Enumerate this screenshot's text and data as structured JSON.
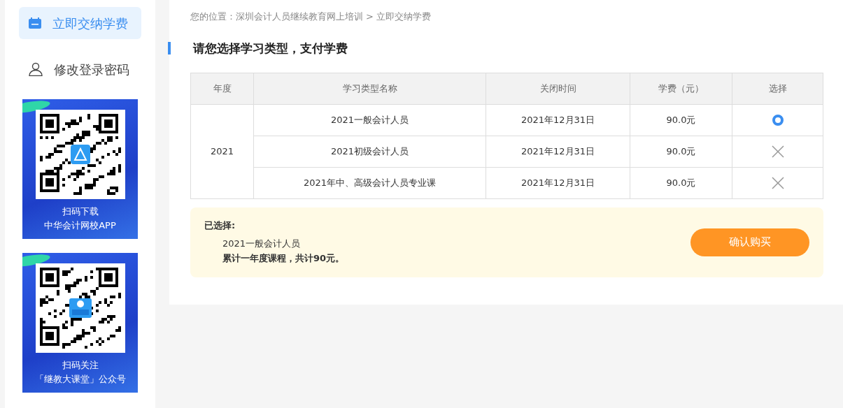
{
  "sidebar": {
    "items": [
      {
        "label": "立即交纳学费",
        "selected": true
      },
      {
        "label": "修改登录密码",
        "selected": false
      }
    ],
    "promos": [
      {
        "title": "扫码下载",
        "subtitle": "中华会计网校APP"
      },
      {
        "title": "扫码关注",
        "subtitle": "「继教大课堂」公众号"
      }
    ]
  },
  "breadcrumb": {
    "prefix": "您的位置：",
    "items": [
      "深圳会计人员继续教育网上培训",
      "立即交纳学费"
    ],
    "separator": ">"
  },
  "heading": "请您选择学习类型，支付学费",
  "table": {
    "columns": [
      "年度",
      "学习类型名称",
      "关闭时间",
      "学费（元）",
      "选择"
    ],
    "groups": [
      {
        "year": "2021",
        "rows": [
          {
            "name": "2021一般会计人员",
            "close_time": "2021年12月31日",
            "fee": "90.0元",
            "kind": "radio",
            "selected": true
          },
          {
            "name": "2021初级会计人员",
            "close_time": "2021年12月31日",
            "fee": "90.0元",
            "kind": "unavailable",
            "selected": false
          },
          {
            "name": "2021年中、高级会计人员专业课",
            "close_time": "2021年12月31日",
            "fee": "90.0元",
            "kind": "unavailable",
            "selected": false
          }
        ]
      }
    ]
  },
  "summary": {
    "label": "已选择:",
    "item": "2021一般会计人员",
    "total": "累计一年度课程，共计90元。",
    "button": "确认购买"
  }
}
